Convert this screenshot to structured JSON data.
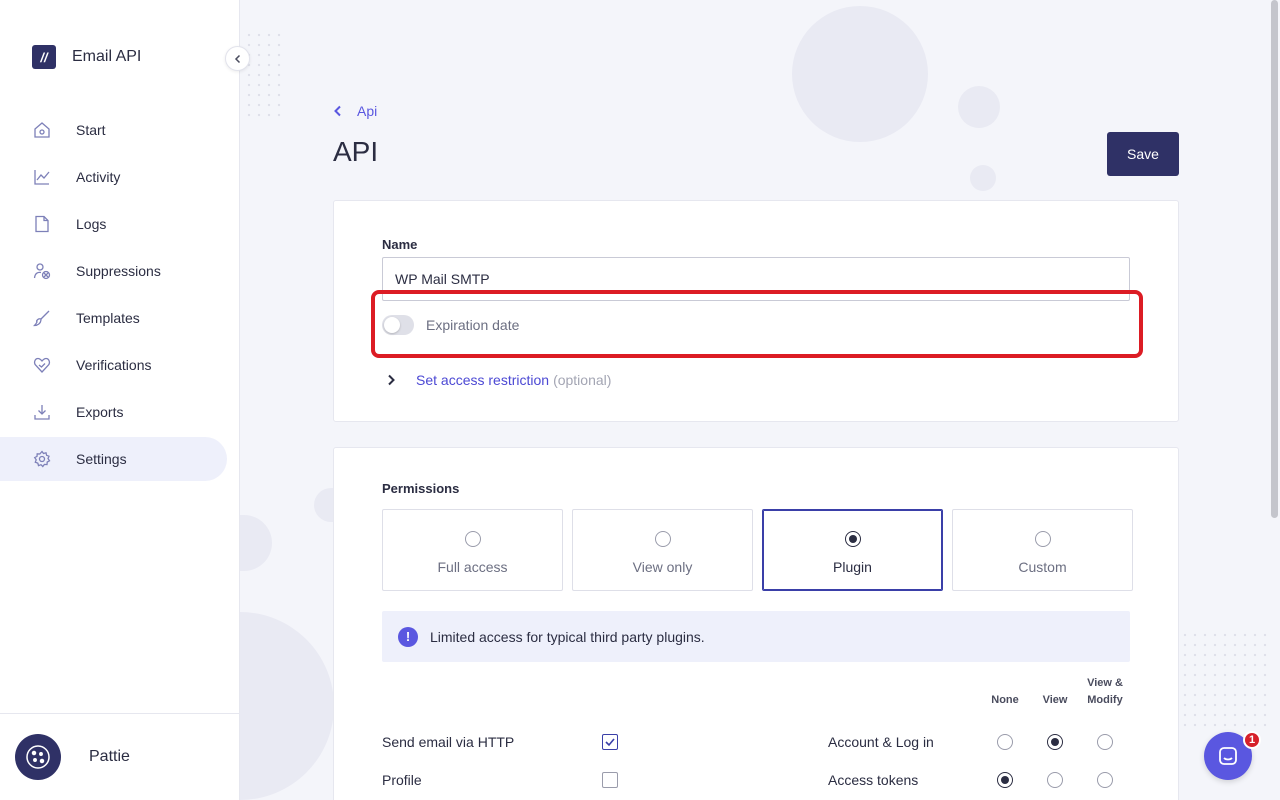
{
  "brand": {
    "name": "Email API",
    "logo_glyph": "//"
  },
  "sidebar": {
    "items": [
      {
        "label": "Start",
        "icon": "home-icon",
        "active": false
      },
      {
        "label": "Activity",
        "icon": "chart-icon",
        "active": false
      },
      {
        "label": "Logs",
        "icon": "file-icon",
        "active": false
      },
      {
        "label": "Suppressions",
        "icon": "user-blocked-icon",
        "active": false
      },
      {
        "label": "Templates",
        "icon": "brush-icon",
        "active": false
      },
      {
        "label": "Verifications",
        "icon": "heart-check-icon",
        "active": false
      },
      {
        "label": "Exports",
        "icon": "download-icon",
        "active": false
      },
      {
        "label": "Settings",
        "icon": "gear-icon",
        "active": true
      }
    ]
  },
  "user": {
    "name": "Pattie"
  },
  "header": {
    "breadcrumb": "Api",
    "title": "API",
    "save_label": "Save"
  },
  "form": {
    "name_label": "Name",
    "name_value": "WP Mail SMTP",
    "expiration_label": "Expiration date",
    "access_link": "Set access restriction",
    "access_optional": "(optional)"
  },
  "permissions": {
    "label": "Permissions",
    "options": [
      "Full access",
      "View only",
      "Plugin",
      "Custom"
    ],
    "selected": "Plugin",
    "info": "Limited access for typical third party plugins."
  },
  "matrix": {
    "columns": [
      "None",
      "View",
      "View & Modify"
    ],
    "left_rows": [
      {
        "label": "Send email via HTTP",
        "checked": true
      },
      {
        "label": "Profile",
        "checked": false
      }
    ],
    "right_rows": [
      {
        "label": "Account & Log in",
        "selected": "View"
      },
      {
        "label": "Access tokens",
        "selected": "None"
      }
    ]
  },
  "chat": {
    "badge": "1"
  },
  "colors": {
    "primary": "#2f3166",
    "accent": "#5a57e0",
    "highlight": "#dc1c24",
    "danger_badge": "#d6202a"
  }
}
